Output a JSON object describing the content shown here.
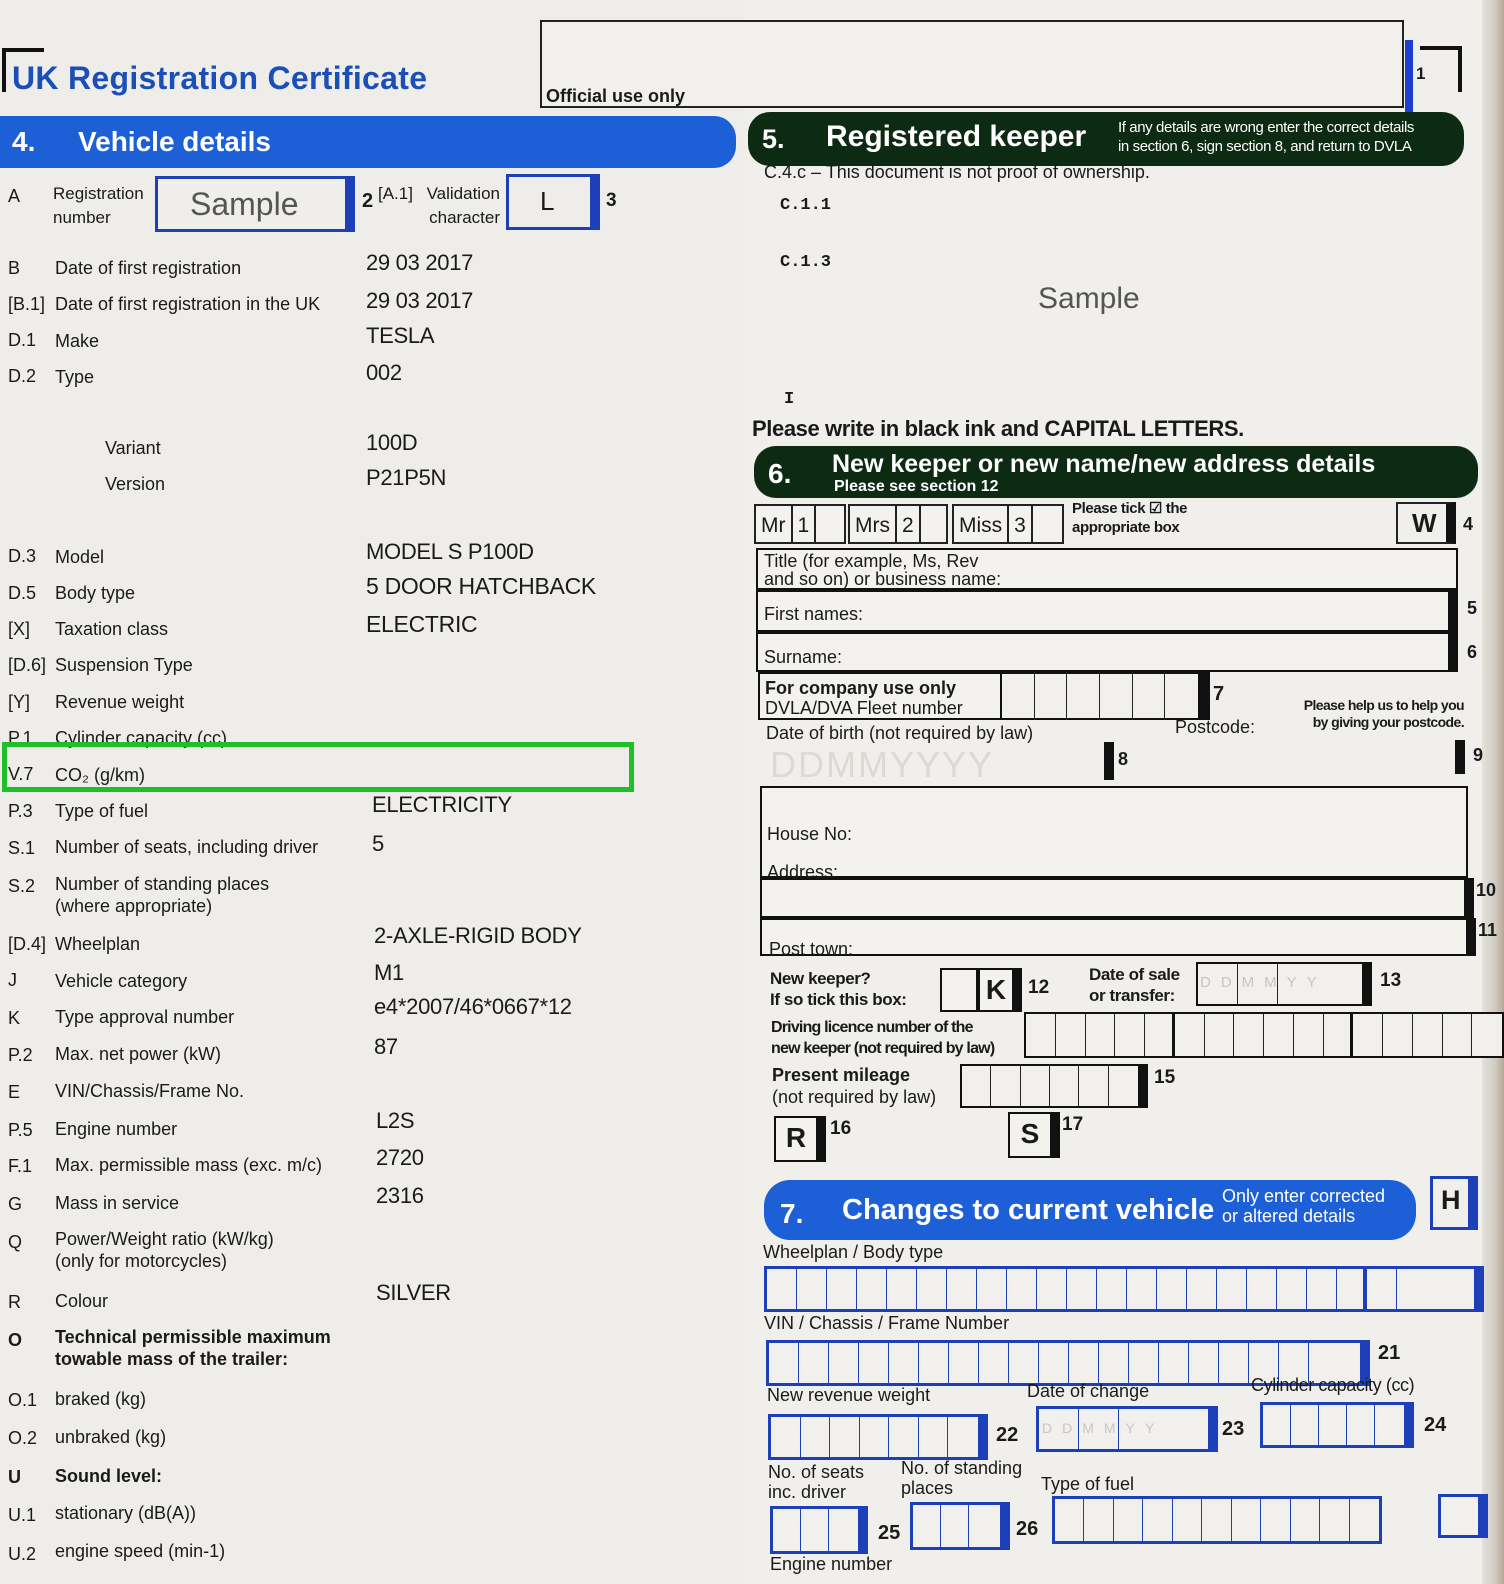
{
  "document": {
    "title": "UK Registration Certificate",
    "official_use_label": "Official use only",
    "page_number": "1"
  },
  "section4": {
    "number": "4.",
    "title": "Vehicle details",
    "registration": {
      "code": "A",
      "label_line1": "Registration",
      "label_line2": "number",
      "value": "Sample",
      "box_number": "2"
    },
    "validation": {
      "code": "[A.1]",
      "label_line1": "Validation",
      "label_line2": "character",
      "value": "L",
      "box_number": "3"
    },
    "rows": [
      {
        "code": "B",
        "label": "Date of first registration",
        "value": "29 03 2017"
      },
      {
        "code": "[B.1]",
        "label": "Date of first registration in the UK",
        "value": "29 03 2017"
      },
      {
        "code": "D.1",
        "label": "Make",
        "value": "TESLA"
      },
      {
        "code": "D.2",
        "label": "Type",
        "value": "002"
      },
      {
        "code": "",
        "label": "Variant",
        "value": "100D"
      },
      {
        "code": "",
        "label": "Version",
        "value": "P21P5N"
      },
      {
        "code": "D.3",
        "label": "Model",
        "value": "MODEL S P100D"
      },
      {
        "code": "D.5",
        "label": "Body type",
        "value": "5 DOOR HATCHBACK"
      },
      {
        "code": "[X]",
        "label": "Taxation class",
        "value": "ELECTRIC"
      },
      {
        "code": "[D.6]",
        "label": "Suspension Type",
        "value": ""
      },
      {
        "code": "[Y]",
        "label": "Revenue weight",
        "value": ""
      },
      {
        "code": "P.1",
        "label": "Cylinder capacity (cc)",
        "value": ""
      },
      {
        "code": "V.7",
        "label": "CO₂ (g/km)",
        "value": ""
      },
      {
        "code": "P.3",
        "label": "Type of fuel",
        "value": "ELECTRICITY"
      },
      {
        "code": "S.1",
        "label": "Number of seats, including driver",
        "value": "5"
      },
      {
        "code": "S.2",
        "label": "Number of standing places",
        "label2": "(where appropriate)",
        "value": ""
      },
      {
        "code": "[D.4]",
        "label": "Wheelplan",
        "value": "2-AXLE-RIGID BODY"
      },
      {
        "code": "J",
        "label": "Vehicle category",
        "value": "M1"
      },
      {
        "code": "K",
        "label": "Type approval number",
        "value": "e4*2007/46*0667*12"
      },
      {
        "code": "P.2",
        "label": "Max. net power (kW)",
        "value": "87"
      },
      {
        "code": "E",
        "label": "VIN/Chassis/Frame No.",
        "value": ""
      },
      {
        "code": "P.5",
        "label": "Engine number",
        "value": "L2S"
      },
      {
        "code": "F.1",
        "label": "Max. permissible mass (exc. m/c)",
        "value": "2720"
      },
      {
        "code": "G",
        "label": "Mass in service",
        "value": "2316"
      },
      {
        "code": "Q",
        "label": "Power/Weight ratio (kW/kg)",
        "label2": "(only for motorcycles)",
        "value": ""
      },
      {
        "code": "R",
        "label": "Colour",
        "value": "SILVER"
      },
      {
        "code": "O",
        "label": "Technical permissible maximum",
        "label2": "towable mass of the trailer:",
        "value": ""
      },
      {
        "code": "O.1",
        "label": "braked (kg)",
        "value": ""
      },
      {
        "code": "O.2",
        "label": "unbraked (kg)",
        "value": ""
      },
      {
        "code": "U",
        "label": "Sound level:",
        "value": ""
      },
      {
        "code": "U.1",
        "label": "stationary (dB(A))",
        "value": ""
      },
      {
        "code": "U.2",
        "label": "engine speed (min-1)",
        "value": ""
      }
    ],
    "highlight_color": "#1fbf2a"
  },
  "section5": {
    "number": "5.",
    "title": "Registered keeper",
    "note_line1": "If any details are wrong enter the correct details",
    "note_line2": "in section 6, sign section 8, and return to DVLA",
    "ownership_note": "C.4.c – This document is not proof of ownership.",
    "c11": "C.1.1",
    "c13": "C.1.3",
    "keeper_value": "Sample",
    "i_label": "I"
  },
  "instruction": {
    "prefix": "Please write in black ink and ",
    "emphasis": "CAPITAL LETTERS."
  },
  "section6": {
    "number": "6.",
    "title": "New keeper or new name/new address details",
    "subtitle": "Please see section 12",
    "titles": [
      {
        "label": "Mr",
        "num": "1"
      },
      {
        "label": "Mrs",
        "num": "2"
      },
      {
        "label": "Miss",
        "num": "3"
      }
    ],
    "tick_note_line1": "Please tick ☑ the",
    "tick_note_line2": "appropriate box",
    "w_box": "W",
    "w_num": "4",
    "title_field_line1": "Title (for example, Ms, Rev",
    "title_field_line2": "and so on) or business name:",
    "first_names": "First names:",
    "first_num": "5",
    "surname": "Surname:",
    "surname_num": "6",
    "company_line1": "For company use only",
    "company_line2": "DVLA/DVA Fleet number",
    "fleet_num": "7",
    "dob_label": "Date of birth (not required by law)",
    "dob_placeholder": "DDMMYYYY",
    "dob_num": "8",
    "postcode_label": "Postcode:",
    "postcode_note_line1": "Please help us to help you",
    "postcode_note_line2": "by giving your postcode.",
    "postcode_num": "9",
    "house_no": "House No:",
    "address": "Address:",
    "address_num": "10",
    "post_town": "Post town:",
    "post_town_num": "11",
    "new_keeper_line1": "New keeper?",
    "new_keeper_line2": "If so tick this box:",
    "k_box": "K",
    "k_num": "12",
    "date_sale_line1": "Date of sale",
    "date_sale_line2": "or transfer:",
    "date_sale_placeholder": "DDMMYY",
    "date_sale_num": "13",
    "licence_line1": "Driving licence number of the",
    "licence_line2": "new keeper (not required by law)",
    "mileage_line1": "Present mileage",
    "mileage_line2": "(not required by law)",
    "mileage_num": "15",
    "r_box": "R",
    "r_num": "16",
    "s_box": "S",
    "s_num": "17"
  },
  "section7": {
    "number": "7.",
    "title": "Changes to current vehicle",
    "note_line1": "Only enter corrected",
    "note_line2": "or altered details",
    "h_box": "H",
    "wheelplan_label": "Wheelplan / Body type",
    "vin_label": "VIN / Chassis / Frame Number",
    "vin_num": "21",
    "revenue_label": "New revenue weight",
    "revenue_num": "22",
    "date_change_label": "Date of change",
    "date_change_placeholder": "DDMMYY",
    "date_change_num": "23",
    "cylinder_label": "Cylinder capacity (cc)",
    "cylinder_num": "24",
    "seats_line1": "No. of seats",
    "seats_line2": "inc. driver",
    "seats_num": "25",
    "standing_line1": "No. of standing",
    "standing_line2": "places",
    "standing_num": "26",
    "fuel_label": "Type of fuel",
    "engine_label": "Engine number"
  },
  "colors": {
    "brand_blue": "#1d5fd6",
    "dark_green": "#0d2a12",
    "title_blue": "#1a4fb8"
  }
}
